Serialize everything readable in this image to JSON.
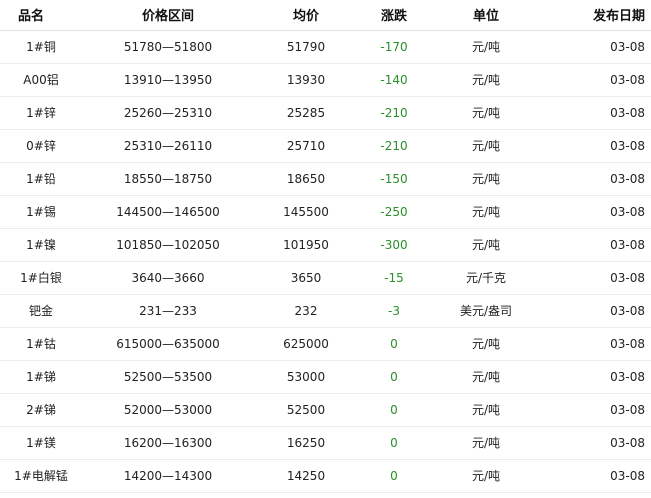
{
  "table": {
    "headers": {
      "name": "品名",
      "range": "价格区间",
      "avg": "均价",
      "change": "涨跌",
      "unit": "单位",
      "date": "发布日期"
    },
    "rows": [
      {
        "name": "1#铜",
        "range": "51780—51800",
        "avg": "51790",
        "change": "-170",
        "unit": "元/吨",
        "date": "03-08"
      },
      {
        "name": "A00铝",
        "range": "13910—13950",
        "avg": "13930",
        "change": "-140",
        "unit": "元/吨",
        "date": "03-08"
      },
      {
        "name": "1#锌",
        "range": "25260—25310",
        "avg": "25285",
        "change": "-210",
        "unit": "元/吨",
        "date": "03-08"
      },
      {
        "name": "0#锌",
        "range": "25310—26110",
        "avg": "25710",
        "change": "-210",
        "unit": "元/吨",
        "date": "03-08"
      },
      {
        "name": "1#铅",
        "range": "18550—18750",
        "avg": "18650",
        "change": "-150",
        "unit": "元/吨",
        "date": "03-08"
      },
      {
        "name": "1#锡",
        "range": "144500—146500",
        "avg": "145500",
        "change": "-250",
        "unit": "元/吨",
        "date": "03-08"
      },
      {
        "name": "1#镍",
        "range": "101850—102050",
        "avg": "101950",
        "change": "-300",
        "unit": "元/吨",
        "date": "03-08"
      },
      {
        "name": "1#白银",
        "range": "3640—3660",
        "avg": "3650",
        "change": "-15",
        "unit": "元/千克",
        "date": "03-08"
      },
      {
        "name": "钯金",
        "range": "231—233",
        "avg": "232",
        "change": "-3",
        "unit": "美元/盎司",
        "date": "03-08"
      },
      {
        "name": "1#钴",
        "range": "615000—635000",
        "avg": "625000",
        "change": "0",
        "unit": "元/吨",
        "date": "03-08"
      },
      {
        "name": "1#锑",
        "range": "52500—53500",
        "avg": "53000",
        "change": "0",
        "unit": "元/吨",
        "date": "03-08"
      },
      {
        "name": "2#锑",
        "range": "52000—53000",
        "avg": "52500",
        "change": "0",
        "unit": "元/吨",
        "date": "03-08"
      },
      {
        "name": "1#镁",
        "range": "16200—16300",
        "avg": "16250",
        "change": "0",
        "unit": "元/吨",
        "date": "03-08"
      },
      {
        "name": "1#电解锰",
        "range": "14200—14300",
        "avg": "14250",
        "change": "0",
        "unit": "元/吨",
        "date": "03-08"
      }
    ]
  },
  "colors": {
    "change_text": "#2a8f2a"
  }
}
